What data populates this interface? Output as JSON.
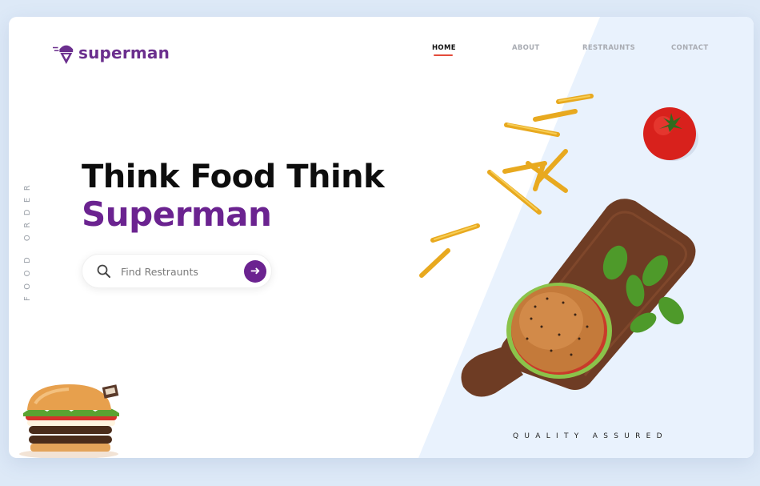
{
  "brand": {
    "name": "superman",
    "color": "#6b2f8e"
  },
  "nav": {
    "items": [
      {
        "label": "HOME",
        "active": true
      },
      {
        "label": "ABOUT",
        "active": false
      },
      {
        "label": "RESTRAUNTS",
        "active": false
      },
      {
        "label": "CONTACT",
        "active": false
      }
    ]
  },
  "side_text": "FOOD ORDER",
  "hero": {
    "line1": "Think Food Think",
    "line2": "Superman"
  },
  "search": {
    "placeholder": "Find Restraunts",
    "icon": "search-icon",
    "button_icon": "arrow-right-icon"
  },
  "footer": {
    "tagline": "QUALITY ASSURED"
  },
  "colors": {
    "accent": "#6b2390",
    "underline": "#e34b3b",
    "panel": "#e9f2fd"
  }
}
